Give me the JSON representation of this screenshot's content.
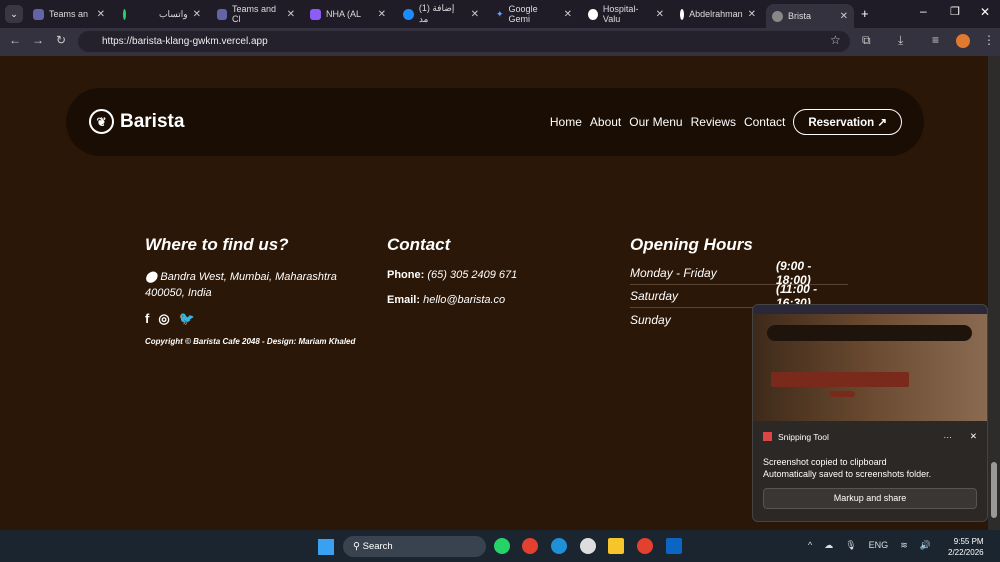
{
  "browser": {
    "tabs": [
      {
        "label": "Teams an"
      },
      {
        "label": "واتساب"
      },
      {
        "label": "Teams and Cl"
      },
      {
        "label": "NHA (AL"
      },
      {
        "label": "(1) إضافة مد"
      },
      {
        "label": "Google Gemi"
      },
      {
        "label": "Hospital-Valu"
      },
      {
        "label": "Abdelrahman"
      },
      {
        "label": "Brista"
      }
    ],
    "url": "https://barista-klang-gwkm.vercel.app"
  },
  "nav": {
    "brand": "Barista",
    "links": [
      "Home",
      "About",
      "Our Menu",
      "Reviews",
      "Contact"
    ],
    "reservation": "Reservation ↗"
  },
  "find": {
    "title": "Where to find us?",
    "address_line1": "Bandra West, Mumbai, Maharashtra",
    "address_line2": "400050, India",
    "copyright": "Copyright © Barista Cafe 2048 - Design: Mariam Khaled"
  },
  "contact": {
    "title": "Contact",
    "phone_label": "Phone:",
    "phone": "(65) 305 2409 671",
    "email_label": "Email:",
    "email": "hello@barista.co"
  },
  "hours": {
    "title": "Opening Hours",
    "rows": [
      {
        "day": "Monday - Friday",
        "time": "(9:00 - 18:00)"
      },
      {
        "day": "Saturday",
        "time": "(11:00 - 16:30)"
      },
      {
        "day": "Sunday",
        "time": ""
      }
    ]
  },
  "toast": {
    "app": "Snipping Tool",
    "more": "···",
    "line1": "Screenshot copied to clipboard",
    "line2": "Automatically saved to screenshots folder.",
    "button": "Markup and share"
  },
  "taskbar": {
    "search": "Search",
    "lang": "ENG",
    "time": "9:55 PM",
    "date": "2/22/2026"
  }
}
